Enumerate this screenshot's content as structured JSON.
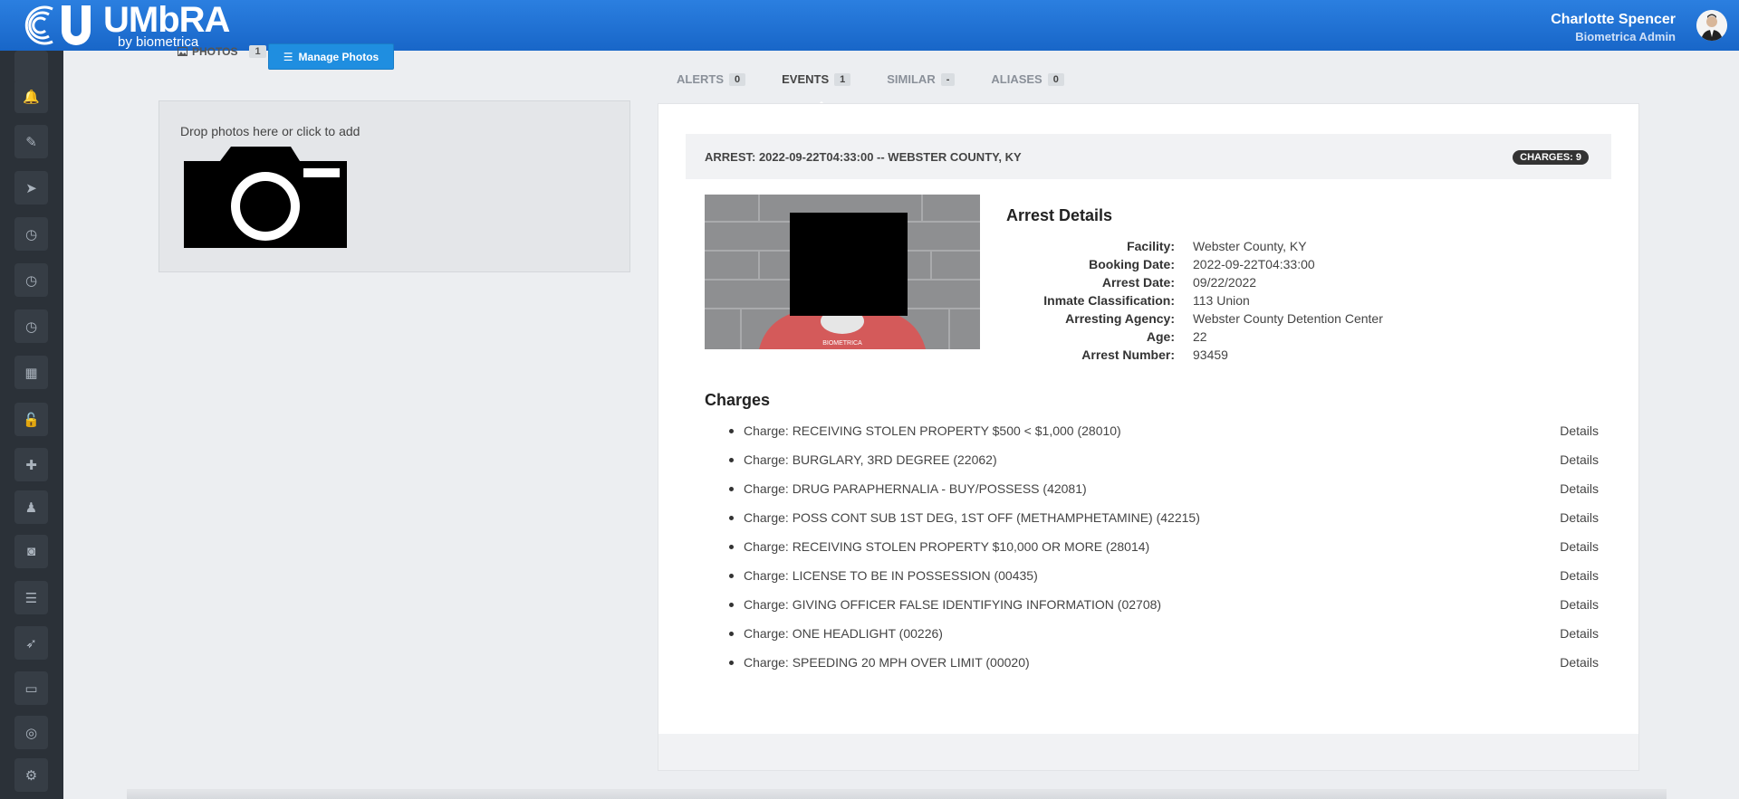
{
  "header": {
    "logo_word": "UMbRA",
    "logo_sub": "by biometrica",
    "user_name": "Charlotte Spencer",
    "user_role": "Biometrica Admin"
  },
  "sidebar": {
    "items": [
      {
        "icon": "bell-icon"
      },
      {
        "icon": "pencil-icon"
      },
      {
        "icon": "paper-plane-icon"
      },
      {
        "icon": "clock-icon"
      },
      {
        "icon": "clock-icon"
      },
      {
        "icon": "clock-icon"
      },
      {
        "icon": "calendar-icon"
      },
      {
        "icon": "unlock-icon"
      },
      {
        "icon": "plus-icon"
      },
      {
        "icon": "person-icon"
      },
      {
        "icon": "camera-icon"
      },
      {
        "icon": "list-icon"
      },
      {
        "icon": "rocket-icon"
      },
      {
        "icon": "book-icon"
      },
      {
        "icon": "life-ring-icon"
      },
      {
        "icon": "gears-icon"
      }
    ]
  },
  "photos": {
    "label": "PHOTOS",
    "count": "1",
    "manage_label": "Manage Photos",
    "drop_text": "Drop photos here or click to add"
  },
  "tabs": [
    {
      "label": "ALERTS",
      "count": "0"
    },
    {
      "label": "EVENTS",
      "count": "1"
    },
    {
      "label": "SIMILAR",
      "count": "-"
    },
    {
      "label": "ALIASES",
      "count": "0"
    }
  ],
  "event": {
    "title": "ARREST: 2022-09-22T04:33:00 -- WEBSTER COUNTY, KY",
    "charges_badge": "CHARGES: 9",
    "mugshot_watermark": "BIOMETRICA",
    "details_title": "Arrest Details",
    "details": [
      {
        "label": "Facility:",
        "value": "Webster County, KY"
      },
      {
        "label": "Booking Date:",
        "value": "2022-09-22T04:33:00"
      },
      {
        "label": "Arrest Date:",
        "value": "09/22/2022"
      },
      {
        "label": "Inmate Classification:",
        "value": "113 Union"
      },
      {
        "label": "Arresting Agency:",
        "value": "Webster County Detention Center"
      },
      {
        "label": "Age:",
        "value": "22"
      },
      {
        "label": "Arrest Number:",
        "value": "93459"
      }
    ],
    "charges_title": "Charges",
    "details_link": "Details",
    "charges": [
      "Charge: RECEIVING STOLEN PROPERTY $500 < $1,000 (28010)",
      "Charge: BURGLARY, 3RD DEGREE (22062)",
      "Charge: DRUG PARAPHERNALIA - BUY/POSSESS (42081)",
      "Charge: POSS CONT SUB 1ST DEG, 1ST OFF (METHAMPHETAMINE) (42215)",
      "Charge: RECEIVING STOLEN PROPERTY $10,000 OR MORE (28014)",
      "Charge: LICENSE TO BE IN POSSESSION (00435)",
      "Charge: GIVING OFFICER FALSE IDENTIFYING INFORMATION (02708)",
      "Charge: ONE HEADLIGHT (00226)",
      "Charge: SPEEDING 20 MPH OVER LIMIT (00020)"
    ]
  }
}
